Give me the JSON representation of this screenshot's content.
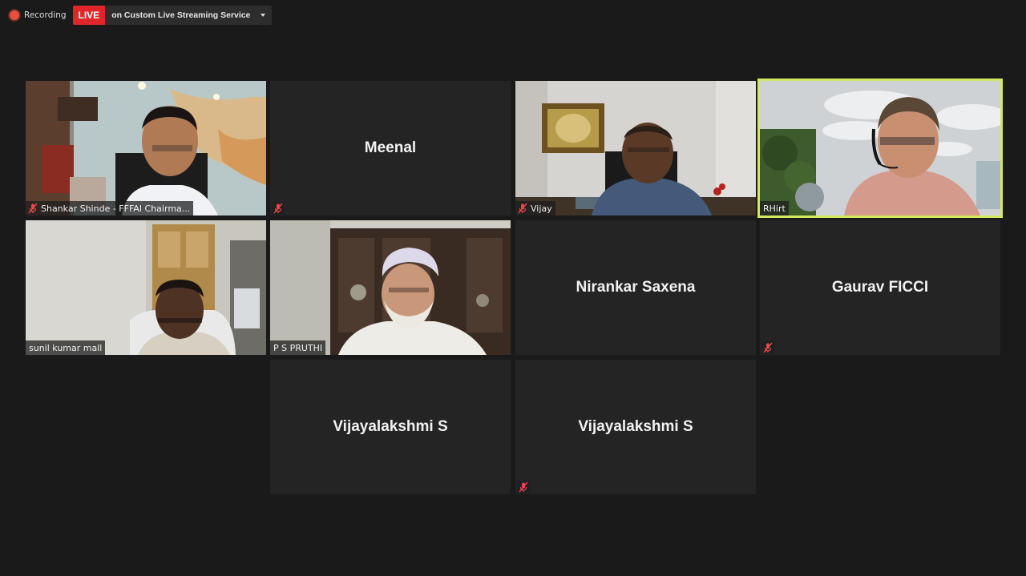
{
  "top_bar": {
    "recording_label": "Recording",
    "live_label": "LIVE",
    "stream_label": "on Custom Live Streaming Service"
  },
  "participants": [
    {
      "id": "p1",
      "name": "Shankar Shinde - FFFAI Chairma...",
      "muted": true,
      "video": true
    },
    {
      "id": "p2",
      "name": "Meenal",
      "muted": true,
      "video": false
    },
    {
      "id": "p3",
      "name": "Vijay",
      "muted": true,
      "video": true
    },
    {
      "id": "p4",
      "name": "RHirt",
      "muted": false,
      "video": true,
      "active_speaker": true
    },
    {
      "id": "p5",
      "name": "sunil kumar mall",
      "muted": false,
      "video": true
    },
    {
      "id": "p6",
      "name": "P S PRUTHI",
      "muted": false,
      "video": true
    },
    {
      "id": "p7",
      "name": "Nirankar Saxena",
      "muted": false,
      "video": false
    },
    {
      "id": "p8",
      "name": "Gaurav FICCI",
      "muted": true,
      "video": false
    },
    {
      "id": "p9",
      "name": "Vijayalakshmi S",
      "muted": false,
      "video": false
    },
    {
      "id": "p10",
      "name": "Vijayalakshmi S",
      "muted": true,
      "video": false
    }
  ],
  "colors": {
    "background": "#1a1a1a",
    "tile": "#242424",
    "live": "#e0262a",
    "active_speaker": "#d3e95f",
    "muted_icon": "#e5484d"
  }
}
